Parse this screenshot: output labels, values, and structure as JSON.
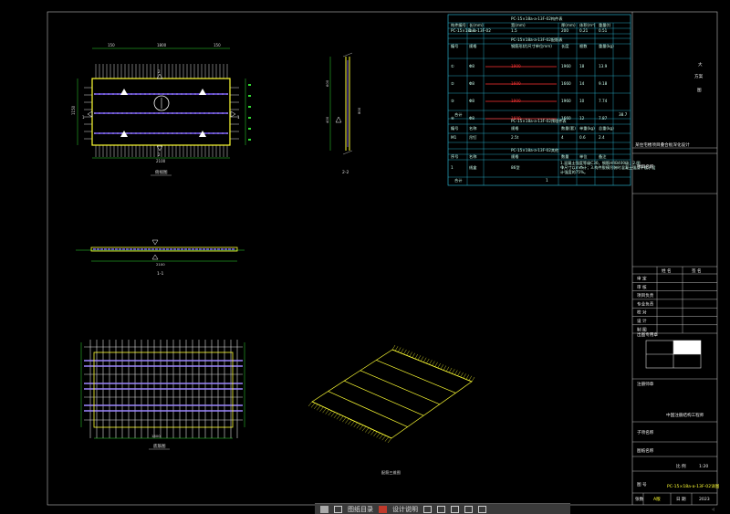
{
  "drawing": {
    "plan_title": "俯视图",
    "section_11": "1-1",
    "section_22": "2-2",
    "bottom_plan_title": "底筋图",
    "iso_title": "配筋三维图",
    "dims": {
      "top_left": "150",
      "top_mid": "1800",
      "top_right": "150",
      "bottom_total": "2100",
      "bottom_mid": "1800",
      "left_height": "1150",
      "side_a": "600",
      "side_b": "400",
      "side_c": "800"
    },
    "cut_marks": [
      "1",
      "1",
      "2",
      "2"
    ]
  },
  "table": {
    "title1": "PC-15×18a-a-13F-02构件表",
    "head1": [
      "构件编号",
      "长(mm)",
      "宽(mm)",
      "厚(mm)",
      "体积(m³)",
      "重量(t)"
    ],
    "row1": [
      "PC-15×18a-a-13F-02",
      "1.8",
      "1.5",
      "200",
      "0.21",
      "0.51"
    ],
    "title2": "PC-15×18a-a-13F-02配筋表",
    "head2": [
      "编号",
      "规格",
      "钢筋形状(尺寸单位mm)",
      "长度",
      "根数",
      "重量(kg)"
    ],
    "rows2": [
      [
        "①",
        "Φ8",
        "1900",
        "1960",
        "18",
        "13.9"
      ],
      [
        "②",
        "Φ8",
        "1600",
        "1660",
        "14",
        "9.18"
      ],
      [
        "③",
        "Φ8",
        "1900",
        "1960",
        "10",
        "7.74"
      ],
      [
        "④",
        "Φ8",
        "1600",
        "1660",
        "12",
        "7.87"
      ]
    ],
    "total_label": "合计",
    "total_value": "38.7",
    "title3": "PC-15×18a-a-13F-02预埋件表",
    "head3": [
      "编号",
      "名称",
      "规格",
      "数量(套)",
      "单重(kg)",
      "总重(kg)"
    ],
    "row3": [
      "M1",
      "吊钉",
      "2.5t",
      "4",
      "0.6",
      "2.4"
    ],
    "title4": "PC-15×18a-a-13F-02其他",
    "head4": [
      "序号",
      "名称",
      "规格",
      "数量",
      "单位",
      "备注"
    ],
    "row4": [
      "1",
      "线盒",
      "86型",
      "1",
      "个",
      ""
    ],
    "notes": "1.混凝土强度等级C30，钢筋HRB400级；2.图中尺寸以mm计；3.构件脱模吊装时混凝土强度不低于设计强度的75%。",
    "sum_label": "合计",
    "sum_value": "1"
  },
  "sidebar": {
    "company_line1": "大",
    "company_line2": "方案",
    "company_line3": "图",
    "project_label": "项目名称",
    "project_value": "某住宅楼项目叠合板深化设计",
    "sub_label": "子项名称",
    "rows": [
      "审 定",
      "审 核",
      "项目负责",
      "专业负责",
      "校 对",
      "设 计",
      "制 图"
    ],
    "sign_head": [
      "姓 名",
      "签 名"
    ],
    "stamp_label": "出图专用章",
    "seal_label": "注册师章",
    "seal_value": "中国注册结构工程师",
    "drawing_name_label": "图纸名称",
    "drawing_number_label": "图 号",
    "drawing_number": "PC-15×18a-a-13F-02详图",
    "scale_label": "比 例",
    "scale_value": "1:20",
    "date_label": "日 期",
    "date_value": "2023",
    "version_label": "版 本",
    "version_value": "A版",
    "sheet_label": "张数",
    "sheet_value": "1"
  },
  "taskbar": {
    "item1": "图纸目录",
    "item2": "设计说明"
  },
  "colors": {
    "background": "#000000",
    "slab_outline": "#ffff33",
    "rebar": "#ffffff",
    "rebar_purple": "#7a5cff",
    "dim_green": "#33dd33",
    "table_cyan": "#2ec7e6",
    "table_red": "#ff3333"
  }
}
